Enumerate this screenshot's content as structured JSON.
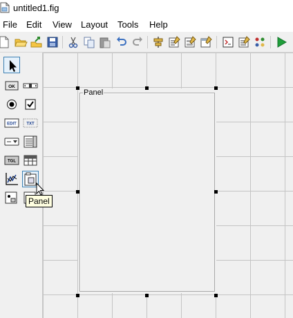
{
  "window": {
    "title": "untitled1.fig"
  },
  "menu": [
    "File",
    "Edit",
    "View",
    "Layout",
    "Tools",
    "Help"
  ],
  "toolbar": {
    "icons": [
      "new-file-icon",
      "open-file-icon",
      "export-icon",
      "save-icon",
      "cut-icon",
      "copy-icon",
      "paste-icon",
      "undo-icon",
      "redo-icon",
      "align-icon",
      "menu-editor-icon",
      "tab-order-icon",
      "toolbar-editor-icon",
      "code-editor-icon",
      "property-inspector-icon",
      "object-browser-icon",
      "run-icon"
    ]
  },
  "palette": {
    "tools": [
      "select-tool",
      "push-button",
      "slider",
      "radio-button",
      "check-box",
      "edit-text",
      "static-text",
      "popup-menu",
      "listbox",
      "toggle-button",
      "table",
      "axes",
      "panel",
      "button-group",
      "activex-control"
    ],
    "labels": {
      "push": "OK",
      "edit": "EDIT",
      "static": "TXT",
      "toggle": "TGL"
    }
  },
  "canvas": {
    "panel_title": "Panel"
  },
  "tooltip": {
    "text": "Panel"
  }
}
